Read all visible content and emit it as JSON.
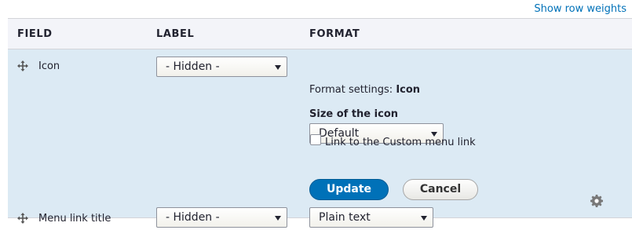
{
  "toolbar": {
    "row_weights_link": "Show row weights"
  },
  "table": {
    "headers": {
      "field": "FIELD",
      "label": "LABEL",
      "format": "FORMAT"
    },
    "rows": [
      {
        "field": "Icon",
        "label_select": "- Hidden -",
        "format_settings_prefix": "Format settings:",
        "format_settings_name": "Icon",
        "size_label": "Size of the icon",
        "size_select": "Default",
        "link_checkbox_label": "Link to the Custom menu link",
        "link_checked": false,
        "update_button": "Update",
        "cancel_button": "Cancel"
      },
      {
        "field": "Menu link title",
        "label_select": "- Hidden -",
        "format_select": "Plain text"
      }
    ]
  },
  "icons": {
    "drag_handle": "move-arrows-icon",
    "settings": "gear-icon"
  },
  "colors": {
    "accent": "#0071b8",
    "active_row_bg": "#dceaf4",
    "header_bg": "#f3f4f9"
  }
}
